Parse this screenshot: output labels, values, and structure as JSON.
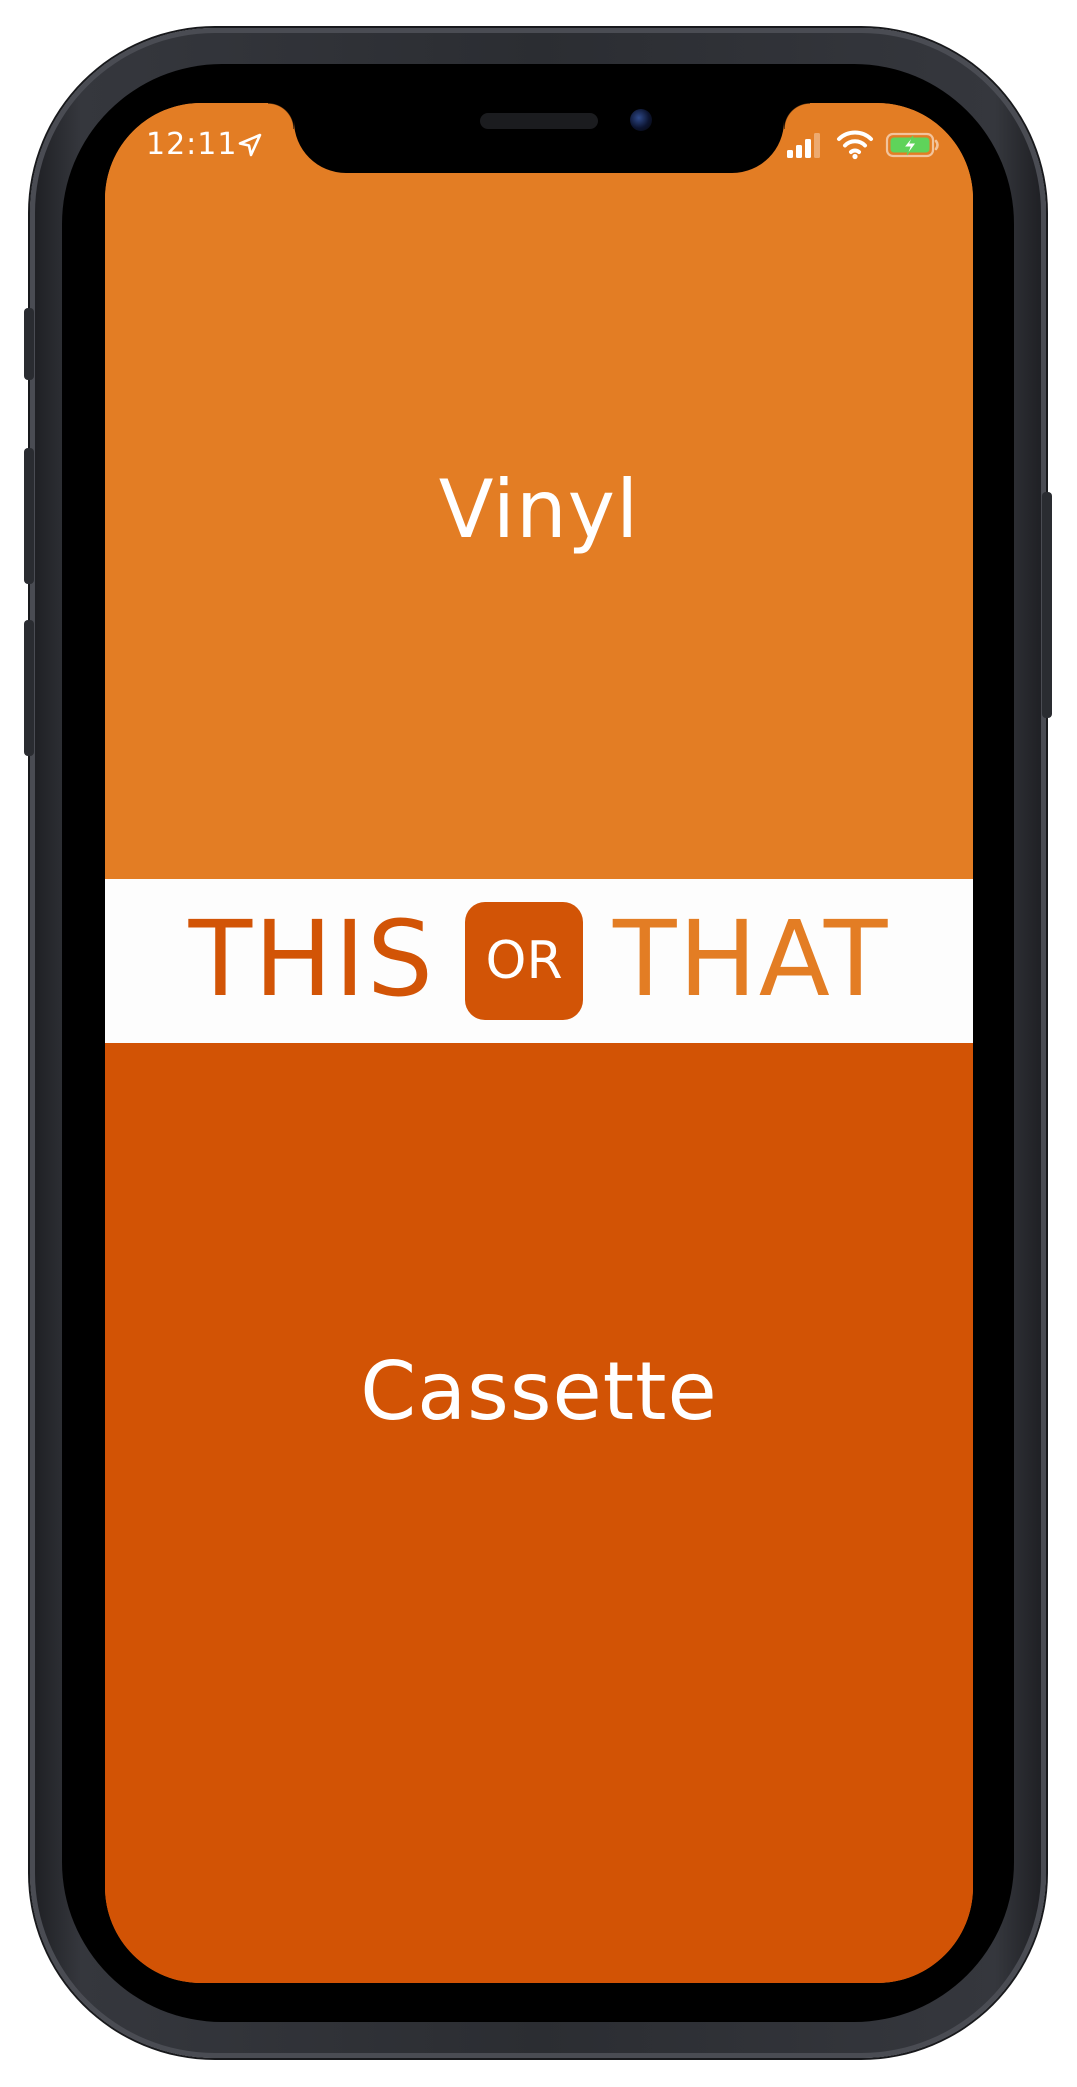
{
  "status_bar": {
    "time": "12:11",
    "icons": [
      "location-arrow-icon",
      "cellular-signal-icon",
      "wifi-icon",
      "battery-charging-icon"
    ]
  },
  "game": {
    "top_option": "Vinyl",
    "bottom_option": "Cassette"
  },
  "logo": {
    "left_word": "THIS",
    "middle_word": "OR",
    "right_word": "THAT"
  },
  "colors": {
    "top_background": "#e37d24",
    "bottom_background": "#d25305",
    "banner_background": "#fdfdfd",
    "logo_dark": "#d25406",
    "logo_light": "#e37d24",
    "battery_fill": "#5fd35a"
  }
}
